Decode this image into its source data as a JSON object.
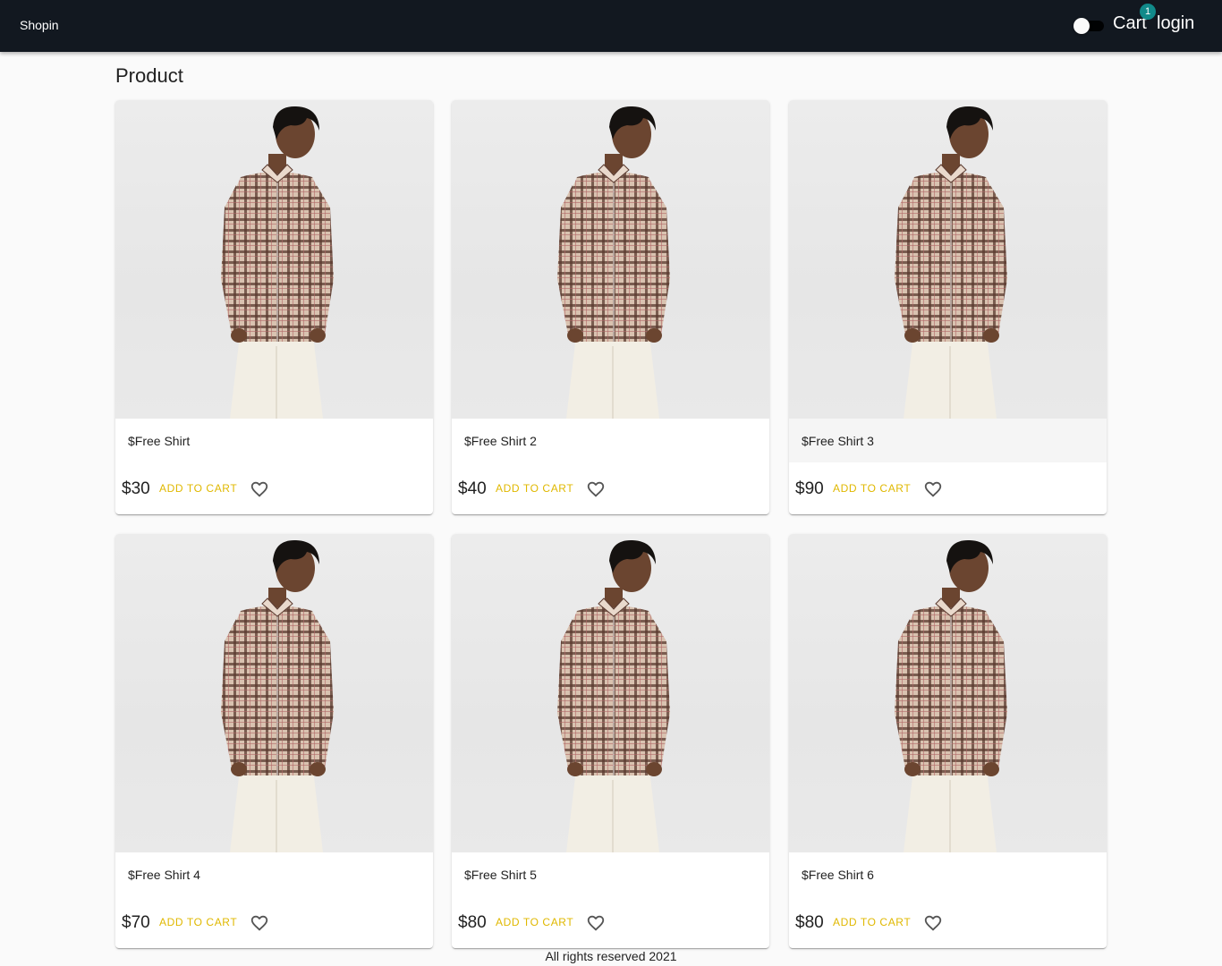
{
  "appbar": {
    "brand": "Shopin",
    "cart_label": "Cart",
    "cart_count": "1",
    "login_label": "login",
    "theme_toggle": {
      "on": false
    }
  },
  "page": {
    "title": "Product"
  },
  "products": [
    {
      "name": "$Free Shirt",
      "price": "$30",
      "add_label": "ADD TO CART",
      "favorite_icon": "heart-outline-icon"
    },
    {
      "name": "$Free Shirt 2",
      "price": "$40",
      "add_label": "ADD TO CART",
      "favorite_icon": "heart-outline-icon"
    },
    {
      "name": "$Free Shirt 3",
      "price": "$90",
      "add_label": "ADD TO CART",
      "favorite_icon": "heart-outline-icon"
    },
    {
      "name": "$Free Shirt 4",
      "price": "$70",
      "add_label": "ADD TO CART",
      "favorite_icon": "heart-outline-icon"
    },
    {
      "name": "$Free Shirt 5",
      "price": "$80",
      "add_label": "ADD TO CART",
      "favorite_icon": "heart-outline-icon"
    },
    {
      "name": "$Free Shirt 6",
      "price": "$80",
      "add_label": "ADD TO CART",
      "favorite_icon": "heart-outline-icon"
    }
  ],
  "footer": {
    "text": "All rights reserved 2021"
  },
  "colors": {
    "appbar": "#121820",
    "accent": "#e0b800",
    "badge": "#118a8a"
  }
}
